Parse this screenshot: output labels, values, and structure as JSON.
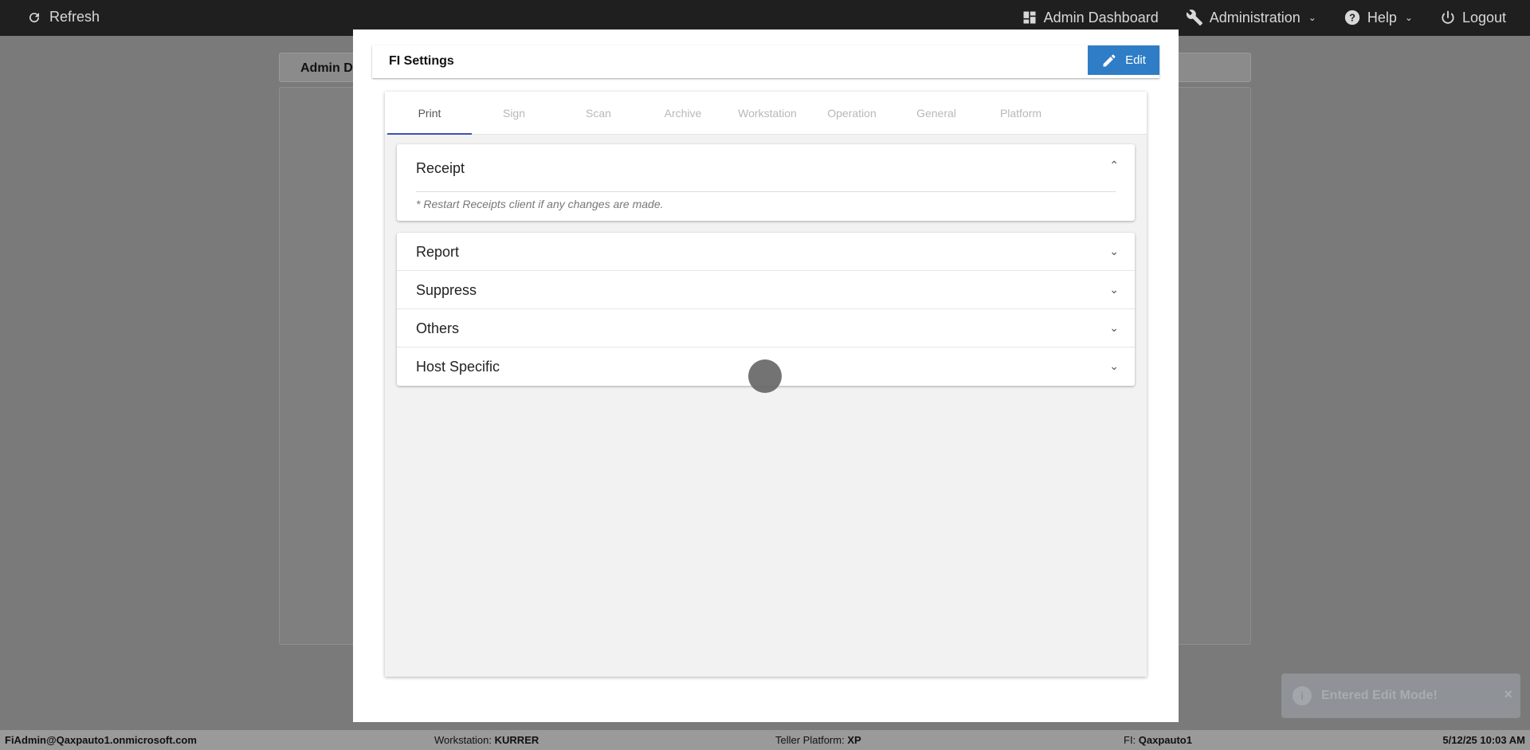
{
  "topbar": {
    "refresh_label": "Refresh",
    "admin_dashboard_label": "Admin Dashboard",
    "administration_label": "Administration",
    "help_label": "Help",
    "logout_label": "Logout"
  },
  "background": {
    "tab_label": "Admin D"
  },
  "modal": {
    "title": "FI Settings",
    "edit_label": "Edit",
    "tabs": [
      "Print",
      "Sign",
      "Scan",
      "Archive",
      "Workstation",
      "Operation",
      "General",
      "Platform"
    ],
    "active_tab": "Print",
    "receipt": {
      "title": "Receipt",
      "note": "* Restart Receipts client if any changes are made."
    },
    "sections": [
      "Report",
      "Suppress",
      "Others",
      "Host Specific"
    ]
  },
  "toast": {
    "message": "Entered Edit Mode!"
  },
  "statusbar": {
    "user": "FiAdmin@Qaxpauto1.onmicrosoft.com",
    "workstation_label": "Workstation:",
    "workstation_value": "KURRER",
    "platform_label": "Teller Platform:",
    "platform_value": "XP",
    "fi_label": "FI:",
    "fi_value": "Qaxpauto1",
    "datetime": "5/12/25 10:03 AM"
  },
  "colors": {
    "accent": "#2f7dc6",
    "tab_indicator": "#3f51b5",
    "topbar": "#1f1f1f"
  }
}
